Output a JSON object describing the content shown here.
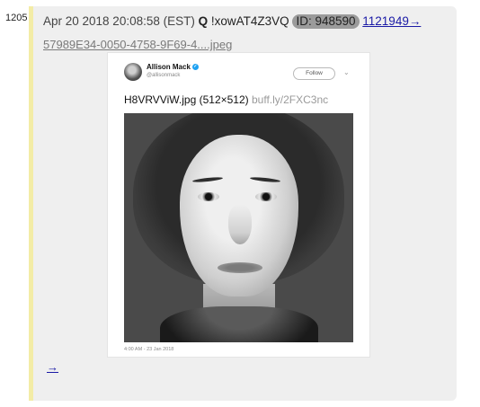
{
  "post": {
    "number": "1205",
    "datetime": "Apr 20 2018 20:08:58 (EST)",
    "trip_q": "Q",
    "tripcode": "!xowAT4Z3VQ",
    "id": "ID: 948590",
    "reply_link": "1121949→",
    "filename": "57989E34-0050-4758-9F69-4....jpeg",
    "backlink": "→"
  },
  "tweet": {
    "name": "Allison Mack",
    "handle": "@allisonmack",
    "follow_label": "Follow",
    "text": "H8VRVViW.jpg (512×512) ",
    "link": "buff.ly/2FXC3nc",
    "timestamp": "4:00 AM - 23 Jan 2018"
  },
  "colors": {
    "post_bg": "#efefef",
    "post_border": "#f3eca6",
    "link": "#1a1aa6",
    "id_badge": "#9b9b9b",
    "verified": "#1da1f2"
  },
  "icons": [
    "verified-icon",
    "chevron-down-icon",
    "avatar"
  ]
}
